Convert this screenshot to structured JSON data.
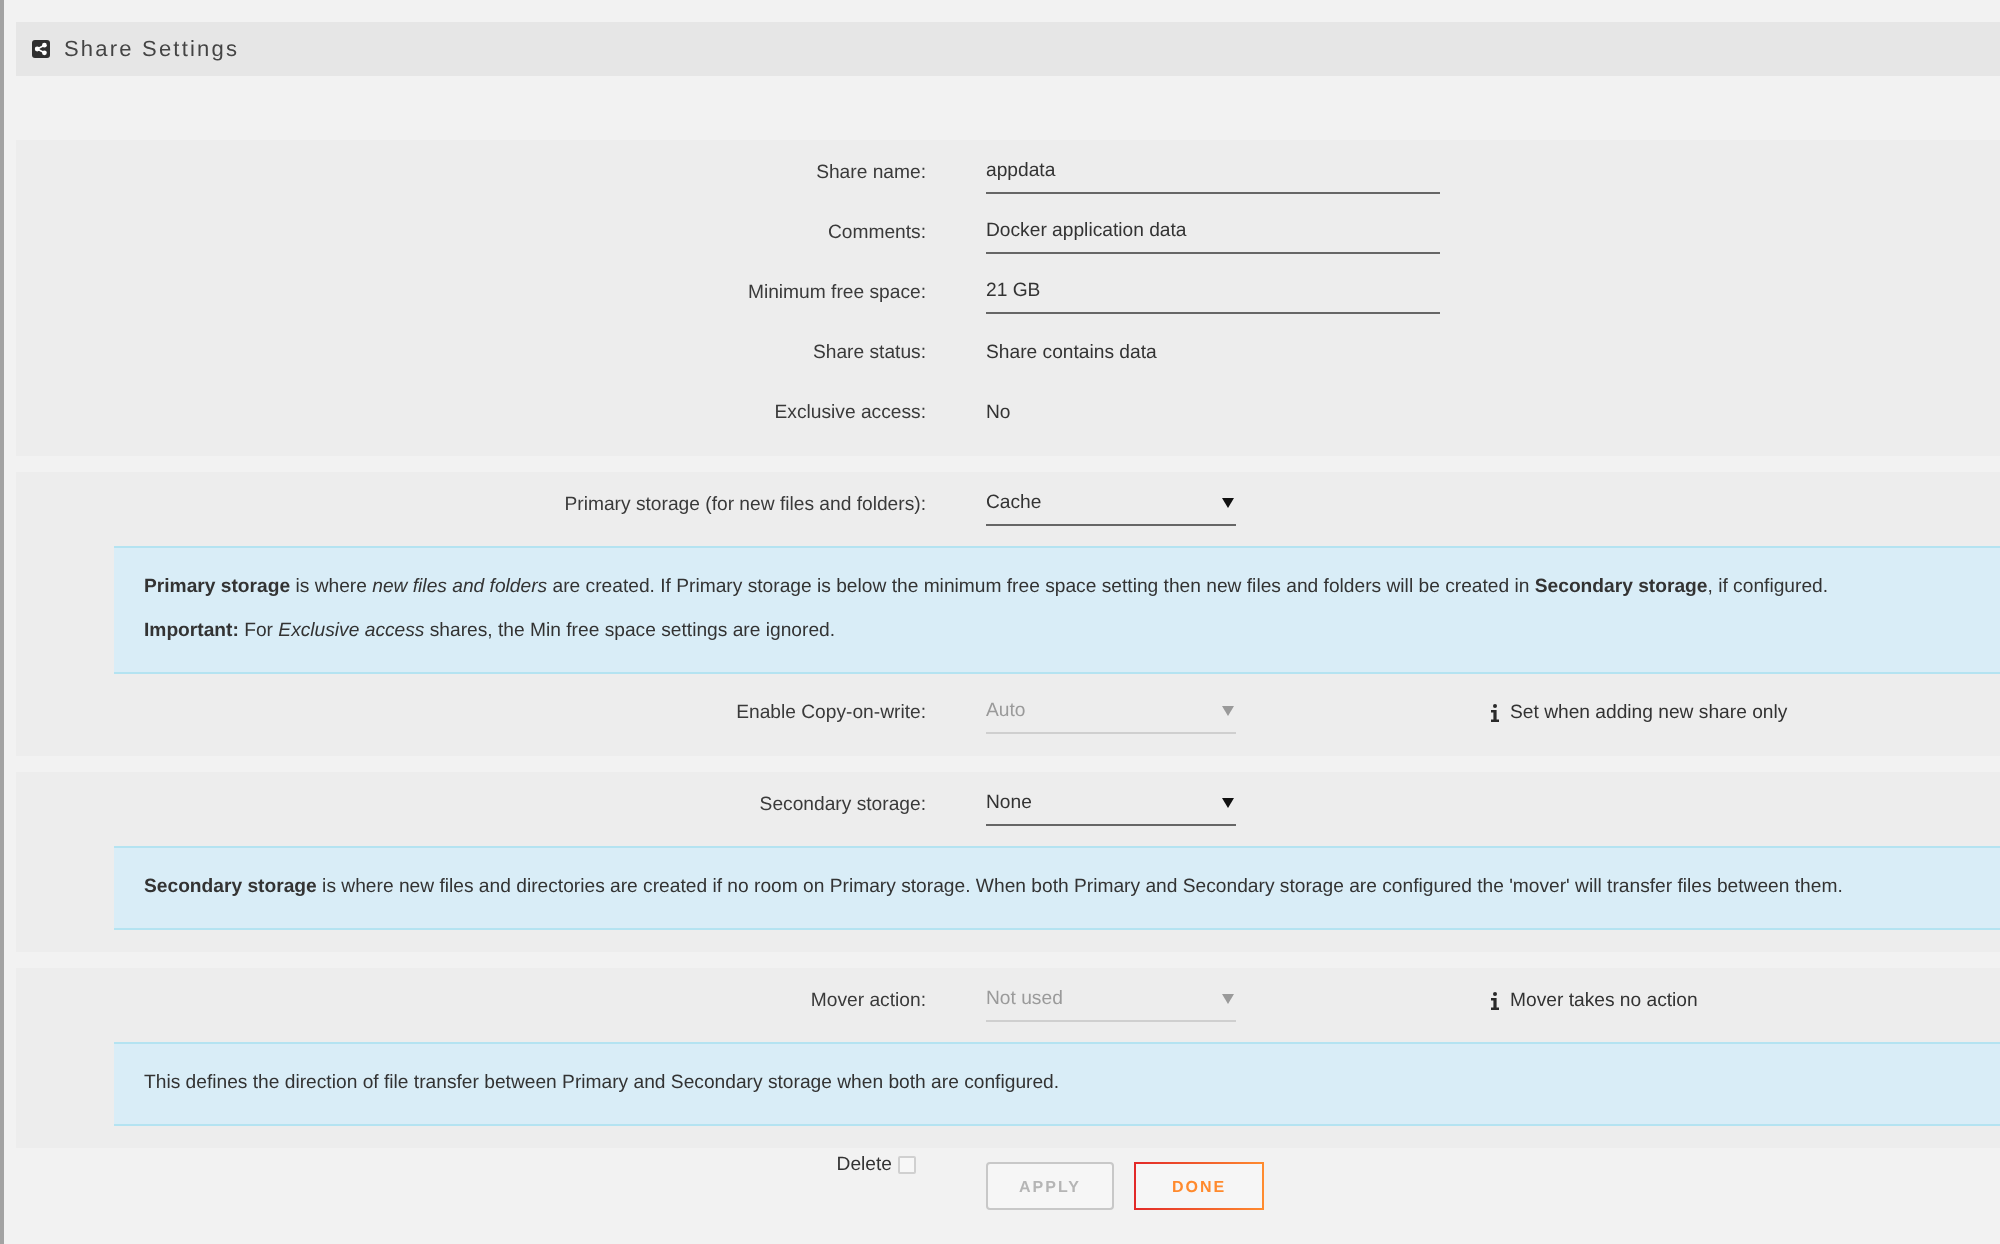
{
  "header": {
    "title": "Share Settings"
  },
  "sections": [
    {
      "rows": [
        {
          "kind": "input",
          "label": "Share name:",
          "value": "appdata"
        },
        {
          "kind": "input",
          "label": "Comments:",
          "value": "Docker application data"
        },
        {
          "kind": "input",
          "label": "Minimum free space:",
          "value": "21 GB"
        },
        {
          "kind": "text",
          "label": "Share status:",
          "value": "Share contains data"
        },
        {
          "kind": "text",
          "label": "Exclusive access:",
          "value": "No"
        }
      ]
    },
    {
      "rows": [
        {
          "kind": "select",
          "label": "Primary storage (for new files and folders):",
          "value": "Cache",
          "disabled": false
        },
        {
          "kind": "info",
          "paragraphs": [
            "**Primary storage** is where *new files and folders* are created. If Primary storage is below the minimum free space setting then new files and folders will be created in **Secondary storage**, if configured.",
            "**Important:** For *Exclusive access* shares, the Min free space settings are ignored."
          ]
        },
        {
          "kind": "select",
          "label": "Enable Copy-on-write:",
          "value": "Auto",
          "disabled": true,
          "note": "Set when adding new share only"
        }
      ]
    },
    {
      "rows": [
        {
          "kind": "select",
          "label": "Secondary storage:",
          "value": "None",
          "disabled": false
        },
        {
          "kind": "info",
          "paragraphs": [
            "**Secondary storage** is where new files and directories are created if no room on Primary storage. When both Primary and Secondary storage are configured the 'mover' will transfer files between them."
          ]
        }
      ]
    },
    {
      "rows": [
        {
          "kind": "select",
          "label": "Mover action:",
          "value": "Not used",
          "disabled": true,
          "note": "Mover takes no action"
        },
        {
          "kind": "info",
          "paragraphs": [
            "This defines the direction of file transfer between Primary and Secondary storage when both are configured."
          ]
        }
      ]
    }
  ],
  "footer": {
    "delete": {
      "label": "Delete",
      "checked": false
    },
    "buttons": [
      {
        "label": "APPLY",
        "disabled": true
      },
      {
        "label": "DONE",
        "disabled": false
      }
    ]
  }
}
